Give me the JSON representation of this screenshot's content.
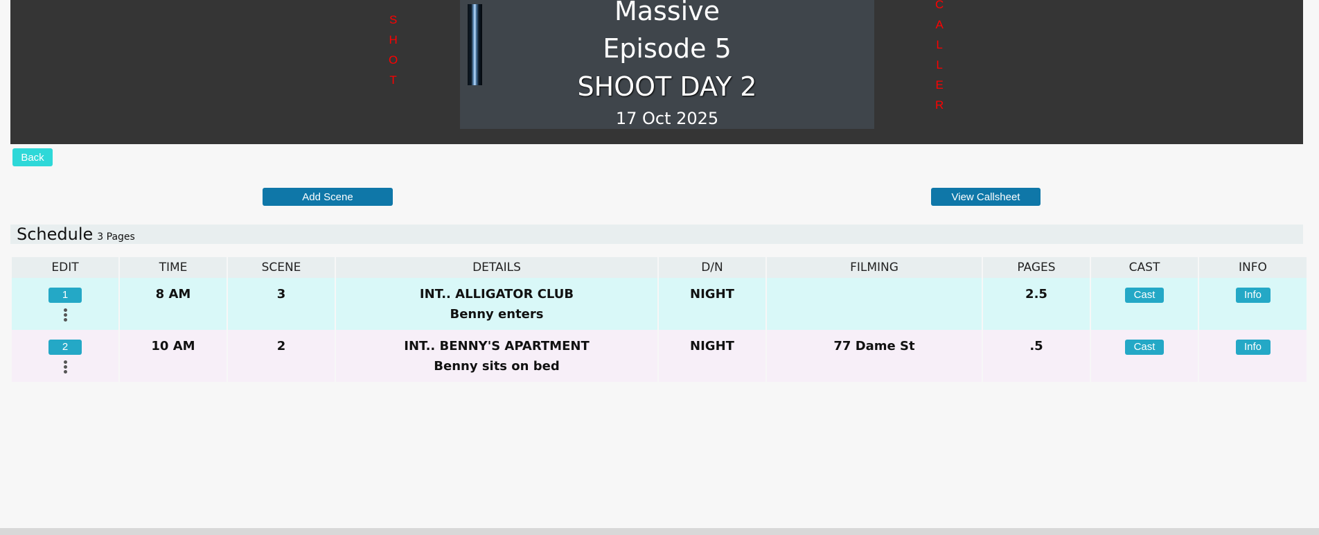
{
  "header": {
    "left_vertical": [
      "S",
      "H",
      "O",
      "T"
    ],
    "right_vertical": [
      "C",
      "A",
      "L",
      "L",
      "E",
      "R"
    ],
    "show_title": "Massive",
    "episode": "Episode 5",
    "shoot_day": "SHOOT DAY 2",
    "date": "17 Oct 2025"
  },
  "nav": {
    "back_label": "Back"
  },
  "actions": {
    "add_scene_label": "Add Scene",
    "view_callsheet_label": "View Callsheet"
  },
  "schedule": {
    "title": "Schedule",
    "pages_label": "3 Pages",
    "columns": [
      "EDIT",
      "TIME",
      "SCENE",
      "DETAILS",
      "D/N",
      "FILMING",
      "PAGES",
      "CAST",
      "INFO"
    ],
    "rows": [
      {
        "edit": "1",
        "time": "8 AM",
        "scene": "3",
        "details_location": "INT.. ALLIGATOR CLUB",
        "details_description": "Benny enters",
        "dn": "NIGHT",
        "filming": "",
        "pages": "2.5",
        "cast_label": "Cast",
        "info_label": "Info"
      },
      {
        "edit": "2",
        "time": "10 AM",
        "scene": "2",
        "details_location": "INT.. BENNY'S APARTMENT",
        "details_description": "Benny sits on bed",
        "dn": "NIGHT",
        "filming": "77 Dame St",
        "pages": ".5",
        "cast_label": "Cast",
        "info_label": "Info"
      }
    ]
  },
  "colors": {
    "header_bg": "#353535",
    "title_panel_bg": "#3f454b",
    "vertical_text": "#ff0000",
    "back_button": "#2ed8d8",
    "primary_button": "#0f77a8",
    "row_button": "#24a8c6",
    "row1_bg": "#d9f8f8",
    "row2_bg": "#f7eff8"
  }
}
